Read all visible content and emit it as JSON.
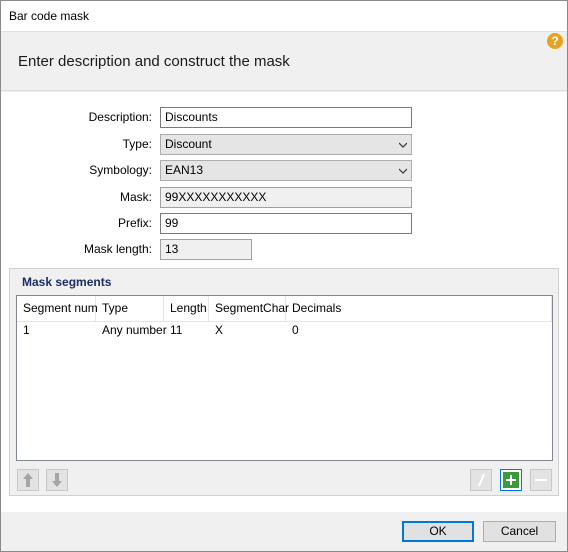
{
  "window": {
    "title": "Bar code mask"
  },
  "header": {
    "heading": "Enter description and construct the mask",
    "help_symbol": "?"
  },
  "form": {
    "description": {
      "label": "Description:",
      "value": "Discounts"
    },
    "type": {
      "label": "Type:",
      "value": "Discount"
    },
    "symbology": {
      "label": "Symbology:",
      "value": "EAN13"
    },
    "mask": {
      "label": "Mask:",
      "value": "99XXXXXXXXXXX"
    },
    "prefix": {
      "label": "Prefix:",
      "value": "99"
    },
    "mask_length": {
      "label": "Mask length:",
      "value": "13"
    }
  },
  "segments": {
    "title": "Mask segments",
    "columns": [
      "Segment num",
      "Type",
      "Length",
      "SegmentChar",
      "Decimals"
    ],
    "rows": [
      [
        "1",
        "Any number",
        "11",
        "X",
        "0"
      ]
    ]
  },
  "buttons": {
    "ok": "OK",
    "cancel": "Cancel"
  },
  "colors": {
    "accent": "#0078d7",
    "add_green": "#3a9a3e",
    "group_title": "#1a2e66",
    "help": "#e7a222"
  },
  "icons": [
    "help-icon",
    "move-up-icon",
    "move-down-icon",
    "edit-icon",
    "add-icon",
    "remove-icon",
    "dropdown-arrow-icon"
  ]
}
